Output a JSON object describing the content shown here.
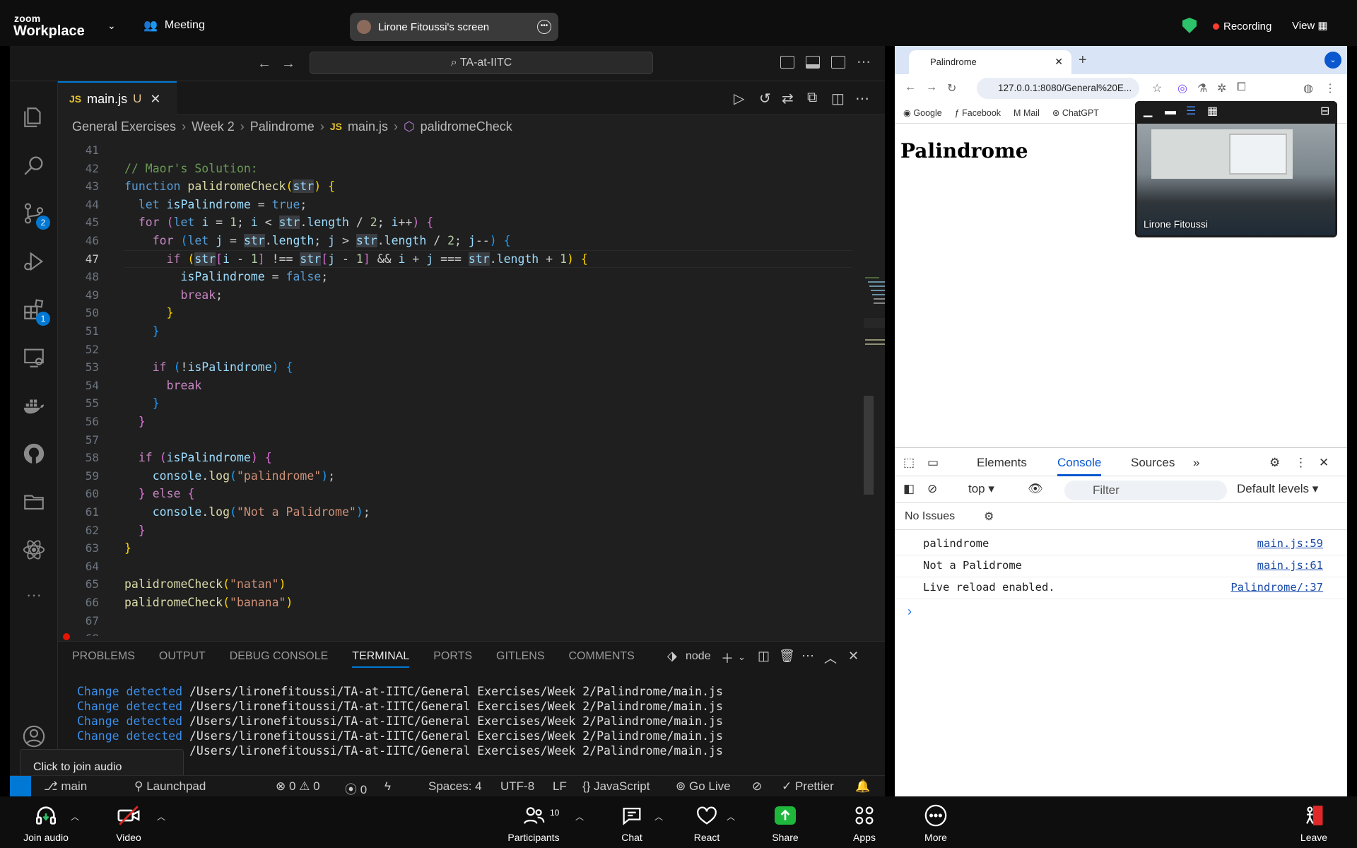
{
  "zoom": {
    "logo_top": "zoom",
    "logo_bottom": "Workplace",
    "meeting_label": "Meeting",
    "screen_share_label": "Lirone Fitoussi's screen",
    "recording_label": "Recording",
    "view_label": "View",
    "bottom": {
      "join_audio": "Join audio",
      "video": "Video",
      "participants": "Participants",
      "participants_count": "10",
      "chat": "Chat",
      "react": "React",
      "share": "Share",
      "apps": "Apps",
      "more": "More",
      "leave": "Leave"
    },
    "tooltip": "Click to join audio",
    "video_name": "Lirone Fitoussi"
  },
  "vscode": {
    "search_text": "TA-at-IITC",
    "tab": {
      "icon": "JS",
      "name": "main.js",
      "status": "U"
    },
    "breadcrumb": [
      "General Exercises",
      "Week 2",
      "Palindrome",
      "main.js",
      "palidromeCheck"
    ],
    "code_lines": [
      {
        "n": "41",
        "html": ""
      },
      {
        "n": "42",
        "html": "<span class=\"cmt\">// Maor's Solution:</span>"
      },
      {
        "n": "43",
        "html": "<span class=\"kf\">function</span> <span class=\"fn\">palidromeCheck</span><span class=\"br1\">(</span><span class=\"var hl\">str</span><span class=\"br1\">)</span> <span class=\"br1\">{</span>"
      },
      {
        "n": "44",
        "html": "  <span class=\"kw\">let</span> <span class=\"var\">isPalindrome</span> = <span class=\"kw\">true</span>;"
      },
      {
        "n": "45",
        "html": "  <span class=\"ctrl\">for</span> <span class=\"br2\">(</span><span class=\"kw\">let</span> <span class=\"var\">i</span> = <span class=\"num\">1</span>; <span class=\"var\">i</span> &lt; <span class=\"var hl\">str</span>.<span class=\"var\">length</span> / <span class=\"num\">2</span>; <span class=\"var\">i</span>++<span class=\"br2\">)</span> <span class=\"br2\">{</span>"
      },
      {
        "n": "46",
        "html": "    <span class=\"ctrl\">for</span> <span class=\"br3\">(</span><span class=\"kw\">let</span> <span class=\"var\">j</span> = <span class=\"var hl\">str</span>.<span class=\"var\">length</span>; <span class=\"var\">j</span> &gt; <span class=\"var hl\">str</span>.<span class=\"var\">length</span> / <span class=\"num\">2</span>; <span class=\"var\">j</span>--<span class=\"br3\">)</span> <span class=\"br3\">{</span>"
      },
      {
        "n": "47",
        "html": "      <span class=\"ctrl\">if</span> <span class=\"br1\">(</span><span class=\"var hl\">str</span><span class=\"br2\">[</span><span class=\"var\">i</span> - <span class=\"num\">1</span><span class=\"br2\">]</span> !== <span class=\"var hl\">str</span><span class=\"br2\">[</span><span class=\"var\">j</span> - <span class=\"num\">1</span><span class=\"br2\">]</span> &amp;&amp; <span class=\"var\">i</span> + <span class=\"var\">j</span> === <span class=\"var hl\">str</span>.<span class=\"var\">length</span> + <span class=\"num\">1</span><span class=\"br1\">)</span> <span class=\"br1\">{</span>"
      },
      {
        "n": "48",
        "html": "        <span class=\"var\">isPalindrome</span> = <span class=\"kw\">false</span>;"
      },
      {
        "n": "49",
        "html": "        <span class=\"ctrl\">break</span>;"
      },
      {
        "n": "50",
        "html": "      <span class=\"br1\">}</span>"
      },
      {
        "n": "51",
        "html": "    <span class=\"br3\">}</span>"
      },
      {
        "n": "52",
        "html": ""
      },
      {
        "n": "53",
        "html": "    <span class=\"ctrl\">if</span> <span class=\"br3\">(</span>!<span class=\"var\">isPalindrome</span><span class=\"br3\">)</span> <span class=\"br3\">{</span>"
      },
      {
        "n": "54",
        "html": "      <span class=\"ctrl\">break</span>"
      },
      {
        "n": "55",
        "html": "    <span class=\"br3\">}</span>"
      },
      {
        "n": "56",
        "html": "  <span class=\"br2\">}</span>"
      },
      {
        "n": "57",
        "html": ""
      },
      {
        "n": "58",
        "html": "  <span class=\"ctrl\">if</span> <span class=\"br2\">(</span><span class=\"var\">isPalindrome</span><span class=\"br2\">)</span> <span class=\"br2\">{</span>"
      },
      {
        "n": "59",
        "html": "    <span class=\"var\">console</span>.<span class=\"fn\">log</span><span class=\"br3\">(</span><span class=\"str\">\"palindrome\"</span><span class=\"br3\">)</span>;"
      },
      {
        "n": "60",
        "html": "  <span class=\"br2\">}</span> <span class=\"ctrl\">else</span> <span class=\"br2\">{</span>"
      },
      {
        "n": "61",
        "html": "    <span class=\"var\">console</span>.<span class=\"fn\">log</span><span class=\"br3\">(</span><span class=\"str\">\"Not a Palidrome\"</span><span class=\"br3\">)</span>;"
      },
      {
        "n": "62",
        "html": "  <span class=\"br2\">}</span>"
      },
      {
        "n": "63",
        "html": "<span class=\"br1\">}</span>"
      },
      {
        "n": "64",
        "html": ""
      },
      {
        "n": "65",
        "html": "<span class=\"fn\">palidromeCheck</span><span class=\"br1\">(</span><span class=\"str\">\"natan\"</span><span class=\"br1\">)</span>"
      },
      {
        "n": "66",
        "html": "<span class=\"fn\">palidromeCheck</span><span class=\"br1\">(</span><span class=\"str\">\"banana\"</span><span class=\"br1\">)</span>"
      },
      {
        "n": "67",
        "html": ""
      },
      {
        "n": "68",
        "html": ""
      }
    ],
    "current_line": "47",
    "panel_tabs": [
      "PROBLEMS",
      "OUTPUT",
      "DEBUG CONSOLE",
      "TERMINAL",
      "PORTS",
      "GITLENS",
      "COMMENTS"
    ],
    "active_panel_tab": "TERMINAL",
    "terminal_shell": "node",
    "terminal_lines": [
      {
        "prefix": "Change detected",
        "path": " /Users/lironefitoussi/TA-at-IITC/General Exercises/Week 2/Palindrome/main.js"
      },
      {
        "prefix": "Change detected",
        "path": " /Users/lironefitoussi/TA-at-IITC/General Exercises/Week 2/Palindrome/main.js"
      },
      {
        "prefix": "Change detected",
        "path": " /Users/lironefitoussi/TA-at-IITC/General Exercises/Week 2/Palindrome/main.js"
      },
      {
        "prefix": "Change detected",
        "path": " /Users/lironefitoussi/TA-at-IITC/General Exercises/Week 2/Palindrome/main.js"
      },
      {
        "prefix": "",
        "path": " /Users/lironefitoussi/TA-at-IITC/General Exercises/Week 2/Palindrome/main.js"
      }
    ],
    "status": {
      "branch": "main",
      "launchpad": "Launchpad",
      "errors": "0",
      "warnings": "0",
      "ports": "0",
      "spaces": "Spaces: 4",
      "encoding": "UTF-8",
      "eol": "LF",
      "language": "JavaScript",
      "golive": "Go Live",
      "prettier": "Prettier"
    },
    "source_control_badge": "2",
    "extensions_badge": "1"
  },
  "chrome": {
    "tab_title": "Palindrome",
    "url": "127.0.0.1:8080/General%20E...",
    "bookmarks": [
      "Google",
      "Facebook",
      "Mail",
      "ChatGPT"
    ],
    "page_heading": "Palindrome",
    "devtools": {
      "tabs": [
        "Elements",
        "Console",
        "Sources"
      ],
      "active_tab": "Console",
      "context": "top",
      "filter_placeholder": "Filter",
      "levels": "Default levels",
      "issues": "No Issues",
      "logs": [
        {
          "text": "palindrome",
          "source": "main.js:59"
        },
        {
          "text": "Not a Palidrome",
          "source": "main.js:61"
        },
        {
          "text": "Live reload enabled.",
          "source": "Palindrome/:37"
        }
      ],
      "prompt": "›"
    }
  }
}
